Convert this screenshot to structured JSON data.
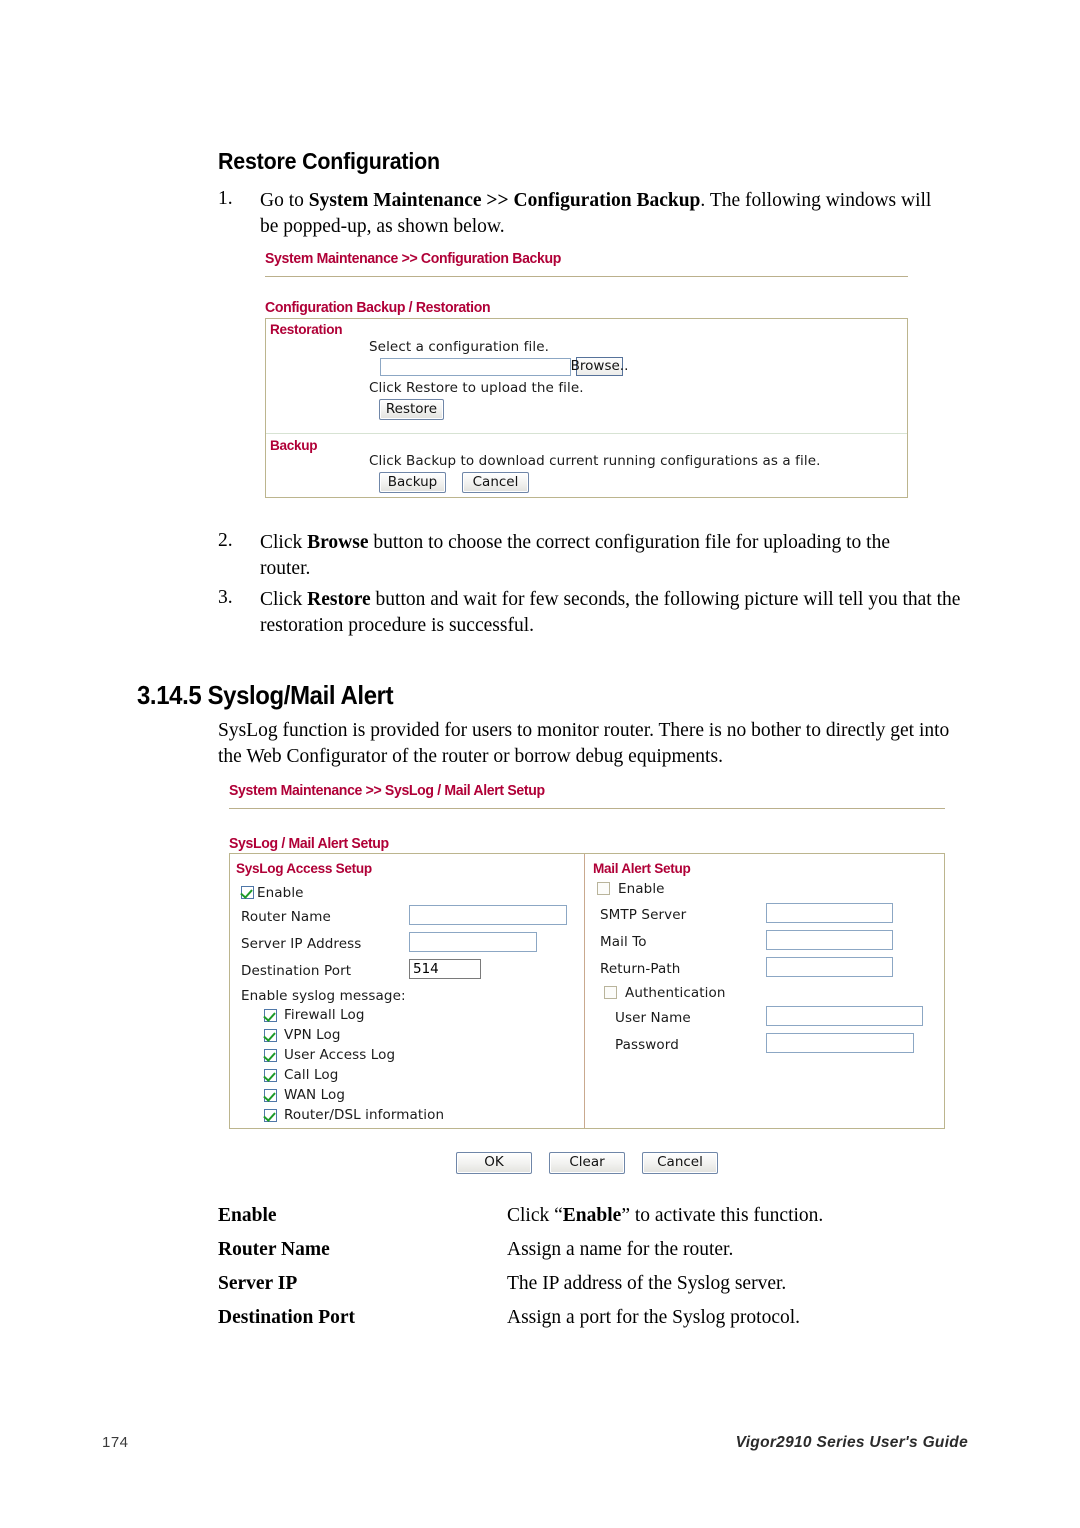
{
  "document": {
    "subheading": "Restore Configuration",
    "steps": [
      {
        "number": "1.",
        "segments": [
          {
            "t": "Go to ",
            "b": false
          },
          {
            "t": "System Maintenance >> Configuration Backup",
            "b": true
          },
          {
            "t": ". The following windows will be popped-up, as shown below.",
            "b": false
          }
        ]
      },
      {
        "number": "2.",
        "segments": [
          {
            "t": "Click ",
            "b": false
          },
          {
            "t": "Browse",
            "b": true
          },
          {
            "t": " button to choose the correct configuration file for uploading to the router.",
            "b": false
          }
        ]
      },
      {
        "number": "3.",
        "segments": [
          {
            "t": "Click ",
            "b": false
          },
          {
            "t": "Restore",
            "b": true
          },
          {
            "t": " button and wait for few seconds, the following picture will tell you that the restoration procedure is successful.",
            "b": false
          }
        ]
      }
    ],
    "section_heading": "3.14.5 Syslog/Mail Alert",
    "section_intro": "SysLog function is provided for users to monitor router. There is no bother to directly get into the Web Configurator of the router or borrow debug equipments.",
    "definitions": [
      {
        "term": "Enable",
        "segments": [
          {
            "t": "Click “",
            "b": false
          },
          {
            "t": "Enable",
            "b": true
          },
          {
            "t": "” to activate this function.",
            "b": false
          }
        ]
      },
      {
        "term": "Router Name",
        "segments": [
          {
            "t": "Assign a name for the router.",
            "b": false
          }
        ]
      },
      {
        "term": "Server IP",
        "segments": [
          {
            "t": "The IP address of the Syslog server.",
            "b": false
          }
        ]
      },
      {
        "term": "Destination Port",
        "segments": [
          {
            "t": "Assign a port for the Syslog protocol.",
            "b": false
          }
        ]
      }
    ],
    "footer": {
      "page_number": "174",
      "guide_title": "Vigor2910 Series User's Guide"
    },
    "colors": {
      "accent_red": "#B00037",
      "panel_border": "#BCB58E",
      "input_border": "#8CA7C4",
      "check_green": "#1E9B28"
    }
  },
  "backup_screenshot": {
    "breadcrumb": "System Maintenance >> Configuration Backup",
    "panel_title": "Configuration Backup / Restoration",
    "restoration": {
      "group_label": "Restoration",
      "select_file_text": "Select a configuration file.",
      "file_value": "",
      "browse_button": "Browse..",
      "hint_text": "Click Restore to upload the file.",
      "restore_button": "Restore"
    },
    "backup": {
      "group_label": "Backup",
      "hint_text": "Click Backup to download current running configurations as a file.",
      "backup_button": "Backup",
      "cancel_button": "Cancel"
    }
  },
  "syslog_screenshot": {
    "breadcrumb": "System Maintenance >> SysLog / Mail Alert Setup",
    "panel_title": "SysLog / Mail Alert Setup",
    "syslog_access": {
      "group_label": "SysLog Access Setup",
      "enable_label": "Enable",
      "enable_checked": true,
      "router_name_label": "Router Name",
      "router_name_value": "",
      "server_ip_label": "Server IP Address",
      "server_ip_value": "",
      "destination_port_label": "Destination Port",
      "destination_port_value": "514",
      "syslog_message_label": "Enable syslog message:",
      "log_options": [
        {
          "label": "Firewall Log",
          "checked": true
        },
        {
          "label": "VPN Log",
          "checked": true
        },
        {
          "label": "User Access Log",
          "checked": true
        },
        {
          "label": "Call Log",
          "checked": true
        },
        {
          "label": "WAN Log",
          "checked": true
        },
        {
          "label": "Router/DSL information",
          "checked": true
        }
      ]
    },
    "mail_alert": {
      "group_label": "Mail Alert Setup",
      "enable_label": "Enable",
      "enable_checked": false,
      "smtp_label": "SMTP Server",
      "smtp_value": "",
      "mail_to_label": "Mail To",
      "mail_to_value": "",
      "return_path_label": "Return-Path",
      "return_path_value": "",
      "authentication_label": "Authentication",
      "authentication_checked": false,
      "user_name_label": "User Name",
      "user_name_value": "",
      "password_label": "Password",
      "password_value": ""
    },
    "actions": {
      "ok_button": "OK",
      "clear_button": "Clear",
      "cancel_button": "Cancel"
    }
  }
}
